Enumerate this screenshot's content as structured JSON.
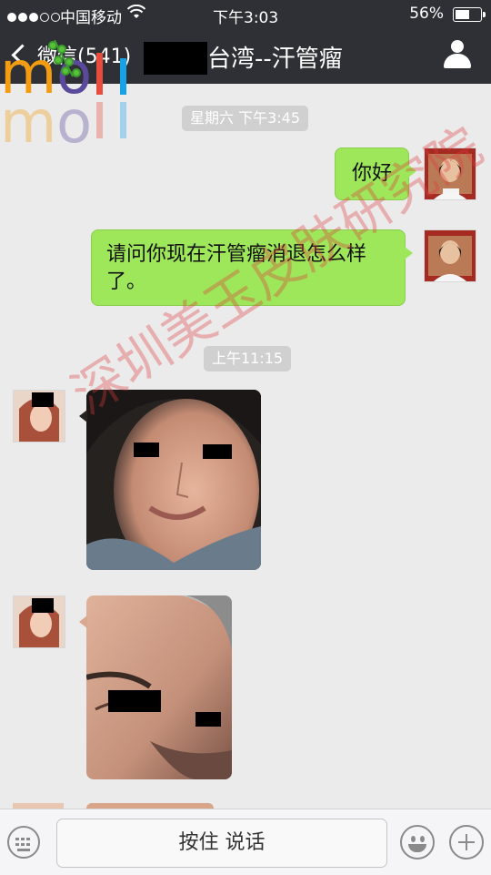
{
  "status_bar": {
    "carrier": "中国移动",
    "time": "下午3:03",
    "battery": "56%",
    "battery_level": 0.56,
    "signal_bars": 3
  },
  "nav": {
    "back_label": "微信(541)",
    "title": "台湾--汗管瘤",
    "back_icon": "chevron-left-icon",
    "contact_icon": "person-icon"
  },
  "logo": {
    "text": "moli",
    "colors": [
      "#f39c12",
      "#e74c3c",
      "#5b4a9b",
      "#17a2e8"
    ]
  },
  "messages": [
    {
      "type": "timestamp",
      "text": "星期六 下午3:45"
    },
    {
      "type": "text",
      "side": "right",
      "text": "你好"
    },
    {
      "type": "text",
      "side": "right",
      "text": "请问你现在汗管瘤消退怎么样了。"
    },
    {
      "type": "timestamp",
      "text": "上午11:15"
    },
    {
      "type": "image",
      "side": "left",
      "description": "photo"
    },
    {
      "type": "image",
      "side": "left",
      "description": "photo"
    }
  ],
  "watermark": "深圳美玉皮肤研究院",
  "input_bar": {
    "hold_to_talk": "按住 说话",
    "keyboard_icon": "keyboard-icon",
    "emoji_icon": "emoji-icon",
    "plus_icon": "plus-icon"
  },
  "colors": {
    "bubble_green": "#9ee75a",
    "nav_bg": "#2e3035",
    "chat_bg": "#ebebeb"
  }
}
